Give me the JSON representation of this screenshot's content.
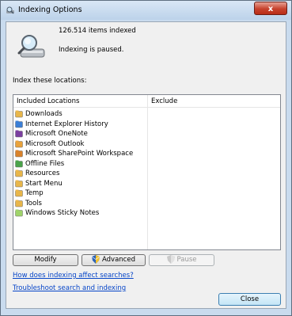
{
  "window": {
    "title": "Indexing Options",
    "close_label": "x"
  },
  "status": {
    "items_indexed": "126.514 items indexed",
    "state": "Indexing is paused."
  },
  "locations": {
    "section_label": "Index these locations:",
    "columns": {
      "included": "Included Locations",
      "exclude": "Exclude"
    },
    "items": [
      {
        "label": "Downloads",
        "icon": "downloads-folder-icon",
        "color": "#e8b64a"
      },
      {
        "label": "Internet Explorer History",
        "icon": "ie-history-icon",
        "color": "#3b7fd6"
      },
      {
        "label": "Microsoft OneNote",
        "icon": "onenote-icon",
        "color": "#7b3fa0"
      },
      {
        "label": "Microsoft Outlook",
        "icon": "outlook-icon",
        "color": "#e9a23b"
      },
      {
        "label": "Microsoft SharePoint Workspace",
        "icon": "sharepoint-workspace-icon",
        "color": "#d9822b"
      },
      {
        "label": "Offline Files",
        "icon": "offline-files-icon",
        "color": "#4aa34a"
      },
      {
        "label": "Resources",
        "icon": "resources-folder-icon",
        "color": "#e8b64a"
      },
      {
        "label": "Start Menu",
        "icon": "start-menu-icon",
        "color": "#e8b64a"
      },
      {
        "label": "Temp",
        "icon": "temp-folder-icon",
        "color": "#e8b64a"
      },
      {
        "label": "Tools",
        "icon": "tools-folder-icon",
        "color": "#e8b64a"
      },
      {
        "label": "Windows Sticky Notes",
        "icon": "sticky-notes-icon",
        "color": "#9fd36a"
      }
    ]
  },
  "buttons": {
    "modify": "Modify",
    "advanced": "Advanced",
    "pause": "Pause",
    "close": "Close"
  },
  "links": {
    "how_affects": "How does indexing affect searches?",
    "troubleshoot": "Troubleshoot search and indexing"
  }
}
